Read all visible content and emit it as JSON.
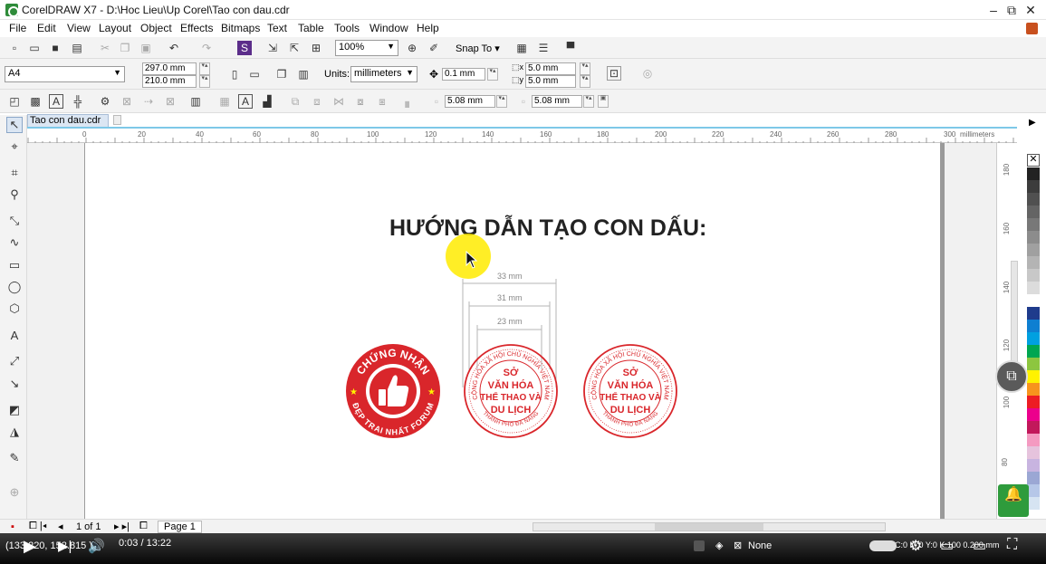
{
  "window": {
    "title": "CorelDRAW X7 - D:\\Hoc Lieu\\Up Corel\\Tao con dau.cdr",
    "minimize": "–",
    "restore": "⧉",
    "close": "✕"
  },
  "menu": [
    "File",
    "Edit",
    "View",
    "Layout",
    "Object",
    "Effects",
    "Bitmaps",
    "Text",
    "Table",
    "Tools",
    "Window",
    "Help"
  ],
  "standard_toolbar": {
    "zoom": "100%",
    "snap_to": "Snap To"
  },
  "property_bar": {
    "page_size": "A4",
    "width": "297.0 mm",
    "height": "210.0 mm",
    "units_label": "Units:",
    "units": "millimeters",
    "nudge": "0.1 mm",
    "dup_x": "5.0 mm",
    "dup_y": "5.0 mm"
  },
  "object_bar": {
    "field1": "5.08 mm",
    "field2": "5.08 mm"
  },
  "document": {
    "tab_label": "Tao con dau.cdr",
    "ruler_units": "millimeters",
    "ruler_ticks": [
      "0",
      "20",
      "40",
      "60",
      "80",
      "100",
      "120",
      "140",
      "160",
      "180",
      "200",
      "220",
      "240",
      "260",
      "280",
      "300"
    ],
    "vruler_ticks": [
      "180",
      "160",
      "140",
      "120",
      "100",
      "80"
    ]
  },
  "canvas": {
    "heading": "HƯỚNG DẪN TẠO CON DẤU:",
    "dimensions": [
      "33 mm",
      "31 mm",
      "23 mm"
    ],
    "stamp1": {
      "top_text": "CHỨNG NHẬN",
      "bottom_text": "ĐẸP TRAI NHẤT FORUM",
      "color": "#d9262b"
    },
    "stamp2": {
      "ring_text": "CỘNG HÒA XÃ HỘI CHỦ NGHĨA VIỆT NAM",
      "bottom_text": "THÀNH PHỐ ĐÀ NẴNG",
      "center_lines": [
        "SỞ",
        "VĂN HÓA",
        "THỂ THAO VÀ",
        "DU LỊCH"
      ],
      "color": "#d9262b"
    },
    "stamp3": {
      "ring_text": "CỘNG HÒA XÃ HỘI CHỦ NGHĨA VIỆT NAM",
      "bottom_text": "THÀNH PHỐ ĐÀ NẴNG",
      "center_lines": [
        "SỞ",
        "VĂN HÓA",
        "THỂ THAO VÀ",
        "DU LỊCH"
      ]
    }
  },
  "page_nav": {
    "page_count": "1 of 1",
    "page_tab": "Page 1"
  },
  "status": {
    "coords": "(133.220, 152.815 )",
    "time": "0:03 / 13:22",
    "fill_label": "None",
    "cmyk": "C:0 M:0 Y:0 K:100 0.200 mm"
  },
  "palette": [
    "#ffffff",
    "#222222",
    "#3c3c3c",
    "#505050",
    "#646464",
    "#787878",
    "#8c8c8c",
    "#a0a0a0",
    "#b4b4b4",
    "#c8c8c8",
    "#dcdcdc",
    "#ffffff",
    "#1f3b8c",
    "#0e7fd1",
    "#00a0e0",
    "#00a651",
    "#8dc63f",
    "#fff200",
    "#f7941d",
    "#ed1c24",
    "#ec008c",
    "#c2185b",
    "#f49ac1",
    "#e6c3dd",
    "#c8b4e0",
    "#9ba7d4",
    "#b6c7e8",
    "#d6e4f2"
  ]
}
